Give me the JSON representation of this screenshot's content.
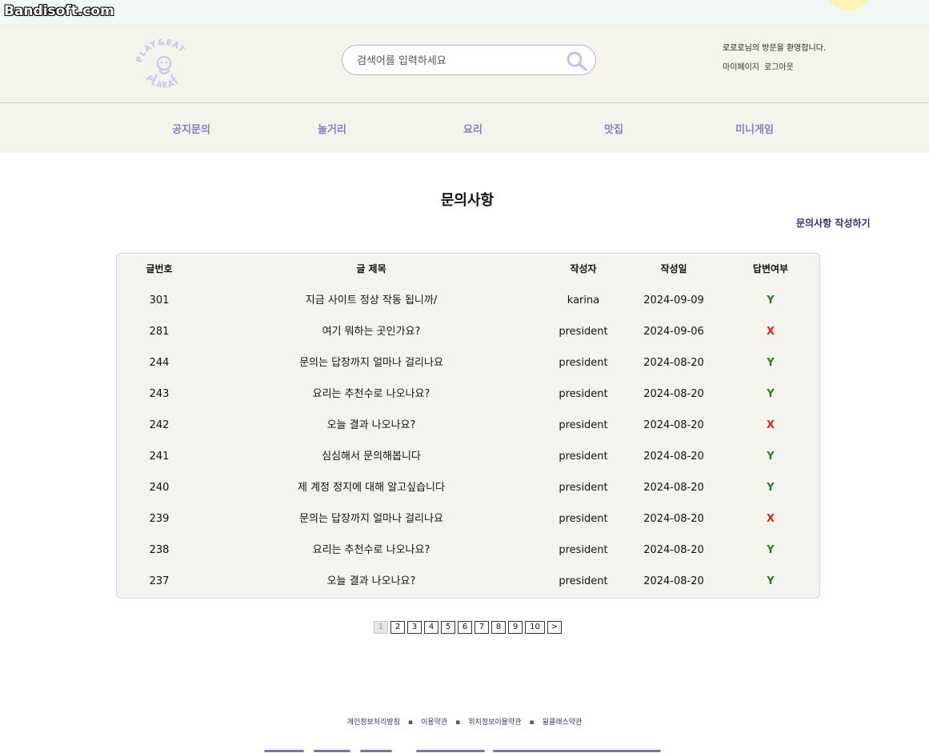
{
  "watermark": "Bandisoft.com",
  "header": {
    "logo_text_top": "PLAY&EAT",
    "logo_text_bottom": "PLAEAT",
    "search_placeholder": "검색어를 입력하세요",
    "welcome": "로로로님의 방문을 환영합니다.",
    "mypage": "마이페이지",
    "logout": "로그아웃"
  },
  "nav": {
    "items": [
      {
        "label": "공지문의"
      },
      {
        "label": "놀거리"
      },
      {
        "label": "요리"
      },
      {
        "label": "맛집"
      },
      {
        "label": "미니게임"
      }
    ]
  },
  "main": {
    "title": "문의사항",
    "write_link": "문의사항 작성하기"
  },
  "table": {
    "headers": [
      "글번호",
      "글 제목",
      "작성자",
      "작성일",
      "답변여부"
    ],
    "rows": [
      {
        "no": "301",
        "title": "지금 사이트 정상 작동 됩니까/",
        "author": "karina",
        "date": "2024-09-09",
        "answered": "Y"
      },
      {
        "no": "281",
        "title": "여기 뭐하는 곳인가요?",
        "author": "president",
        "date": "2024-09-06",
        "answered": "X"
      },
      {
        "no": "244",
        "title": "문의는 답장까지 얼마나 걸리나요",
        "author": "president",
        "date": "2024-08-20",
        "answered": "Y"
      },
      {
        "no": "243",
        "title": "요리는 추천수로 나오나요?",
        "author": "president",
        "date": "2024-08-20",
        "answered": "Y"
      },
      {
        "no": "242",
        "title": "오늘 결과 나오나요?",
        "author": "president",
        "date": "2024-08-20",
        "answered": "X"
      },
      {
        "no": "241",
        "title": "심심해서 문의해봅니다",
        "author": "president",
        "date": "2024-08-20",
        "answered": "Y"
      },
      {
        "no": "240",
        "title": "제 계정 정지에 대해 알고싶습니다",
        "author": "president",
        "date": "2024-08-20",
        "answered": "Y"
      },
      {
        "no": "239",
        "title": "문의는 답장까지 얼마나 걸리나요",
        "author": "president",
        "date": "2024-08-20",
        "answered": "X"
      },
      {
        "no": "238",
        "title": "요리는 추천수로 나오나요?",
        "author": "president",
        "date": "2024-08-20",
        "answered": "Y"
      },
      {
        "no": "237",
        "title": "오늘 결과 나오나요?",
        "author": "president",
        "date": "2024-08-20",
        "answered": "Y"
      }
    ]
  },
  "pagination": {
    "pages": [
      "1",
      "2",
      "3",
      "4",
      "5",
      "6",
      "7",
      "8",
      "9",
      "10"
    ],
    "current": "1",
    "next": ">"
  },
  "footer": {
    "links": [
      "개인정보처리방침",
      "이용약관",
      "위치정보이용약관",
      "윌클래스약관"
    ],
    "separator": "▪"
  },
  "colors": {
    "accent": "#8a7cc4",
    "header_bg": "#f5f3ec",
    "answer_yes": "#2a7a2a",
    "answer_no": "#d62222"
  },
  "icons": [
    "search-icon",
    "logo-icon"
  ]
}
